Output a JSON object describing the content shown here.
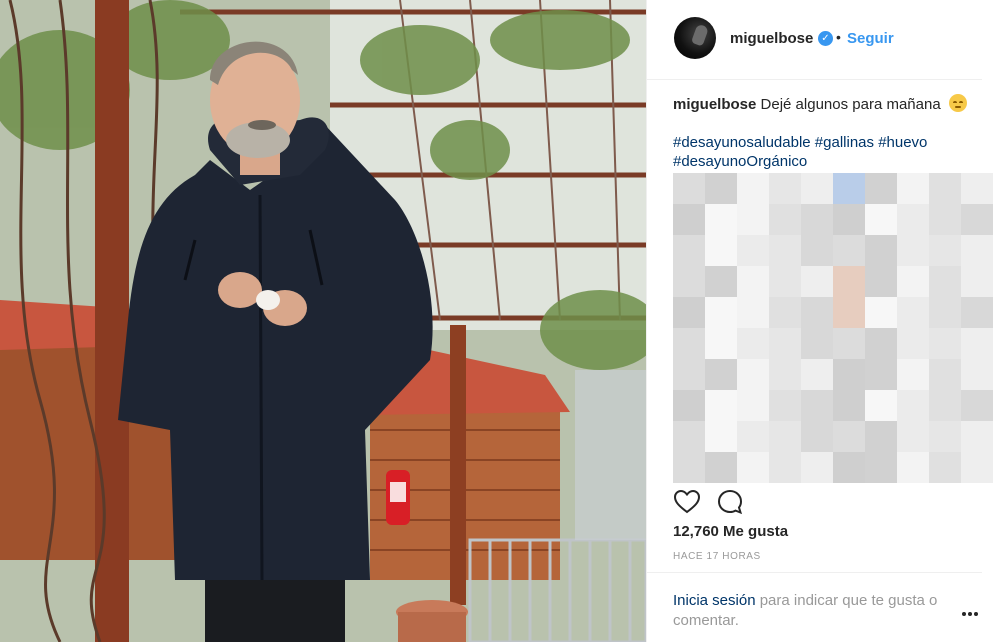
{
  "post": {
    "image_alt": "Man in dark jacket holding an egg in a garden",
    "author": {
      "username": "miguelbose",
      "verified_mark": "✓",
      "separator": "•",
      "follow_label": "Seguir"
    },
    "caption": {
      "username": "miguelbose",
      "text": "Dejé algunos para mañana",
      "emoji": "relieved-face-emoji"
    },
    "hashtags": [
      "#desayunosaludable",
      "#gallinas",
      "#huevo",
      "#desayunoOrgánico"
    ],
    "likes": "12,760 Me gusta",
    "timestamp": "HACE 17 HORAS",
    "login_prompt": {
      "link_text": "Inicia sesión",
      "rest_text": " para indicar que te gusta o comentar."
    }
  },
  "icons": {
    "like": "heart-icon",
    "comment": "comment-icon",
    "more": "more-options-icon",
    "verified": "verified-badge-icon"
  },
  "colors": {
    "link_blue": "#3897f0",
    "hashtag_navy": "#003569",
    "muted_gray": "#999999",
    "text": "#262626",
    "divider": "#efefef"
  }
}
